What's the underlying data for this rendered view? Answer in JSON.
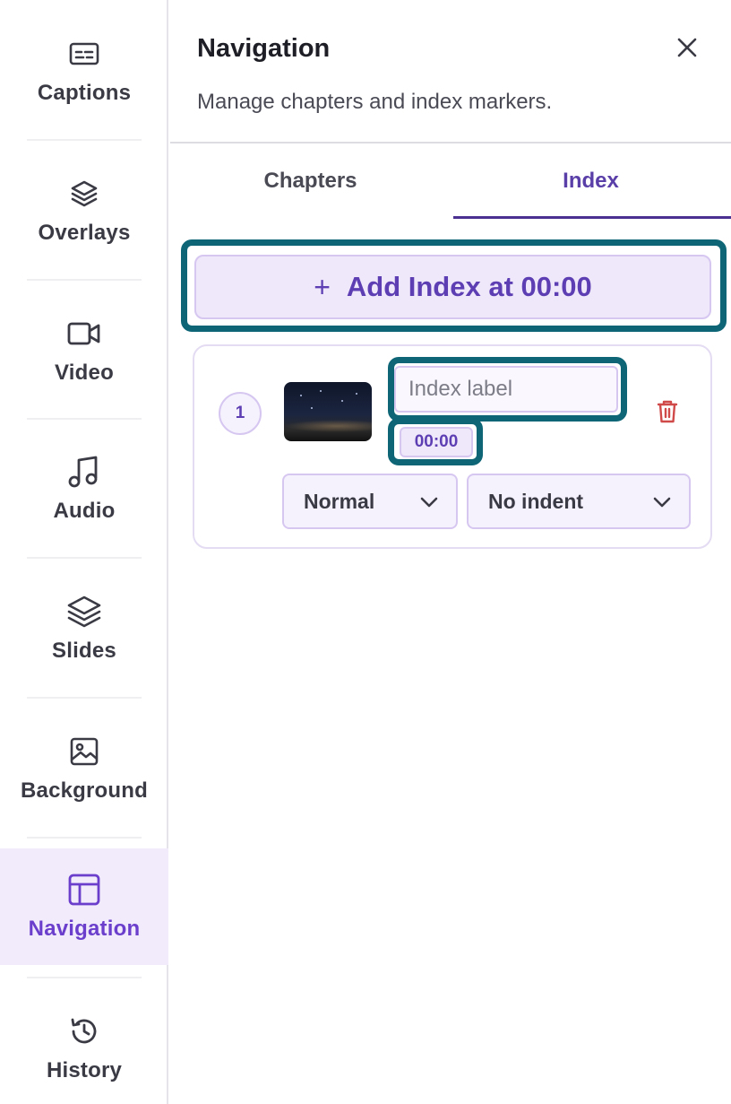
{
  "rail": {
    "items": [
      {
        "label": "Captions",
        "icon": "captions-icon",
        "active": false
      },
      {
        "label": "Overlays",
        "icon": "layers-icon",
        "active": false
      },
      {
        "label": "Video",
        "icon": "video-camera-icon",
        "active": false
      },
      {
        "label": "Audio",
        "icon": "music-note-icon",
        "active": false
      },
      {
        "label": "Slides",
        "icon": "stack-icon",
        "active": false
      },
      {
        "label": "Background",
        "icon": "image-icon",
        "active": false
      },
      {
        "label": "Navigation",
        "icon": "layout-icon",
        "active": true
      },
      {
        "label": "History",
        "icon": "history-icon",
        "active": false
      }
    ]
  },
  "panel": {
    "title": "Navigation",
    "subtitle": "Manage chapters and index markers.",
    "close_icon": "close-icon"
  },
  "tabs": [
    {
      "label": "Chapters",
      "active": false
    },
    {
      "label": "Index",
      "active": true
    }
  ],
  "add_button": {
    "plus": "+",
    "label": "Add Index at 00:00"
  },
  "index_entry": {
    "number": "1",
    "label_value": "",
    "label_placeholder": "Index label",
    "time": "00:00",
    "style_select": "Normal",
    "indent_select": "No indent",
    "delete_icon": "trash-icon"
  },
  "colors": {
    "accent": "#5e3fb3",
    "accent_bg": "#efe8fa",
    "active_rail_bg": "#f1ebfb",
    "highlight_outline": "#0d6575",
    "danger": "#d04a4a"
  }
}
